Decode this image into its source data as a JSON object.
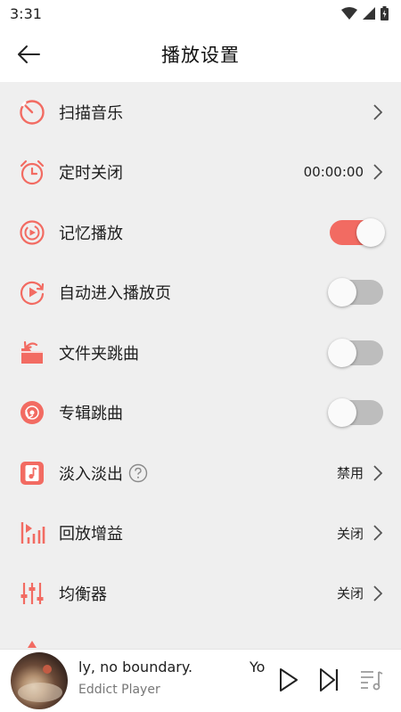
{
  "status_bar": {
    "time": "3:31"
  },
  "header": {
    "title": "播放设置"
  },
  "accent_color": "#f26b62",
  "settings": [
    {
      "label": "扫描音乐",
      "icon": "scan-icon",
      "type": "link"
    },
    {
      "label": "定时关闭",
      "icon": "alarm-clock-icon",
      "type": "link",
      "value": "00:00:00"
    },
    {
      "label": "记忆播放",
      "icon": "memory-play-icon",
      "type": "toggle",
      "on": true
    },
    {
      "label": "自动进入播放页",
      "icon": "auto-play-page-icon",
      "type": "toggle",
      "on": false
    },
    {
      "label": "文件夹跳曲",
      "icon": "folder-icon",
      "type": "toggle",
      "on": false
    },
    {
      "label": "专辑跳曲",
      "icon": "album-disc-icon",
      "type": "toggle",
      "on": false
    },
    {
      "label": "淡入淡出",
      "icon": "fade-music-icon",
      "type": "link",
      "value": "禁用",
      "help": true
    },
    {
      "label": "回放增益",
      "icon": "replay-gain-icon",
      "type": "link",
      "value": "关闭"
    },
    {
      "label": "均衡器",
      "icon": "equalizer-icon",
      "type": "link",
      "value": "关闭"
    }
  ],
  "mini_player": {
    "title_part1": "ly, no boundary.",
    "title_part2": "Yo",
    "artist": "Eddict Player"
  }
}
